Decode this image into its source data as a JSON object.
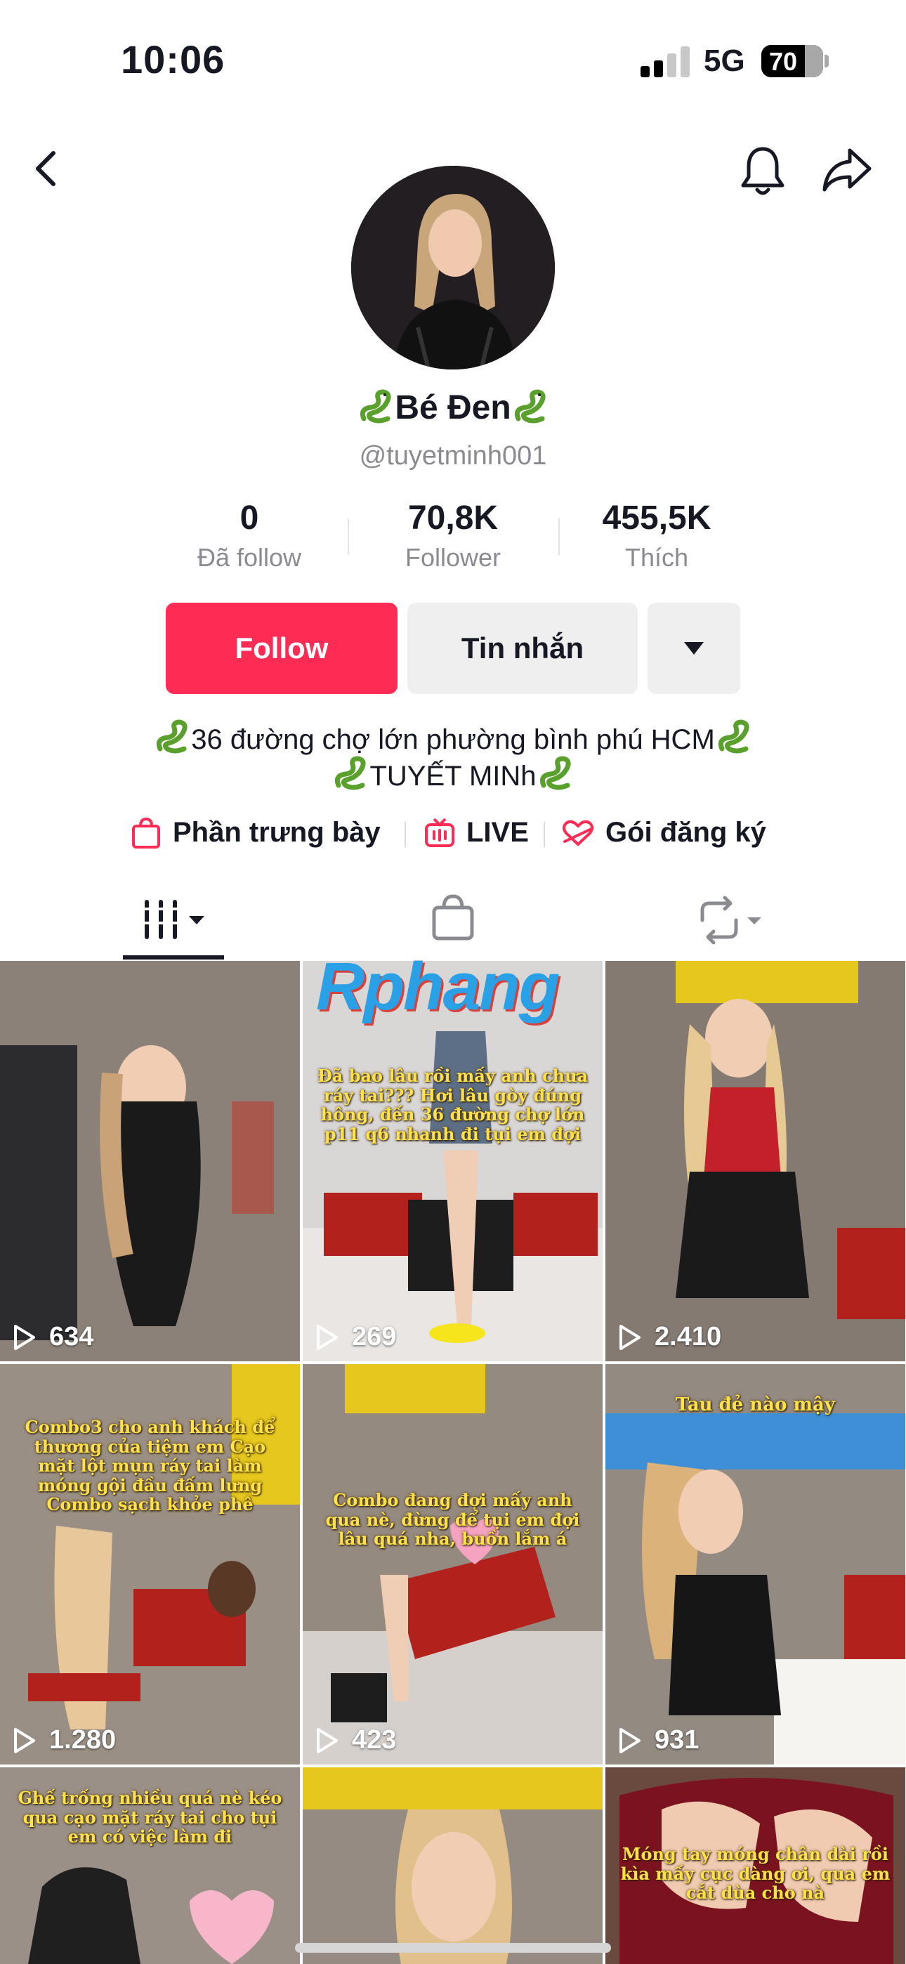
{
  "status": {
    "time": "10:06",
    "network": "5G",
    "battery": "70"
  },
  "profile": {
    "display_name": "Bé Đen",
    "handle": "@tuyetminh001",
    "stats": [
      {
        "value": "0",
        "label": "Đã follow"
      },
      {
        "value": "70,8K",
        "label": "Follower"
      },
      {
        "value": "455,5K",
        "label": "Thích"
      }
    ],
    "follow_label": "Follow",
    "message_label": "Tin nhắn",
    "bio_line1": "36 đường chợ lớn phường bình phú HCM",
    "bio_line2": "TUYẾT MINh"
  },
  "links": [
    {
      "label": "Phần trưng bày",
      "icon": "shopping-bag-icon"
    },
    {
      "label": "LIVE",
      "icon": "live-tv-icon"
    },
    {
      "label": "Gói đăng ký",
      "icon": "heart-ribbon-icon"
    }
  ],
  "tabs": [
    {
      "name": "videos-tab",
      "icon": "grid-bars-icon"
    },
    {
      "name": "shop-tab",
      "icon": "shopping-bag-icon"
    },
    {
      "name": "reposts-tab",
      "icon": "repost-icon"
    }
  ],
  "watermark": "Rphang",
  "videos": [
    {
      "views": "634",
      "caption": ""
    },
    {
      "views": "269",
      "caption": "Đã bao lâu rồi mấy anh chưa ráy tai??? Hơi lâu gòy đúng hông, đến 36 đường chợ lớn p11 q6 nhanh đi tụi em đợi"
    },
    {
      "views": "2.410",
      "caption": ""
    },
    {
      "views": "1.280",
      "caption": "Combo3 cho anh khách để thương của tiệm em Cạo mặt lột mụn ráy tai làm móng gội đầu đấm lưng Combo sạch khỏe phê"
    },
    {
      "views": "423",
      "caption": "Combo đang đợi mấy anh qua nè, đừng để tụi em đợi lâu quá nha, buồn lắm á"
    },
    {
      "views": "931",
      "caption": "Tau đẻ nào mậy"
    },
    {
      "views": "",
      "caption": "Ghế trống nhiều quá nè kéo qua cạo mặt ráy tai cho tụi em có việc làm đi"
    },
    {
      "views": "",
      "caption": ""
    },
    {
      "views": "",
      "caption": "Móng tay móng chân dài rồi kìa mấy cục dàng ơi, qua em cắt dùa cho nà"
    }
  ]
}
